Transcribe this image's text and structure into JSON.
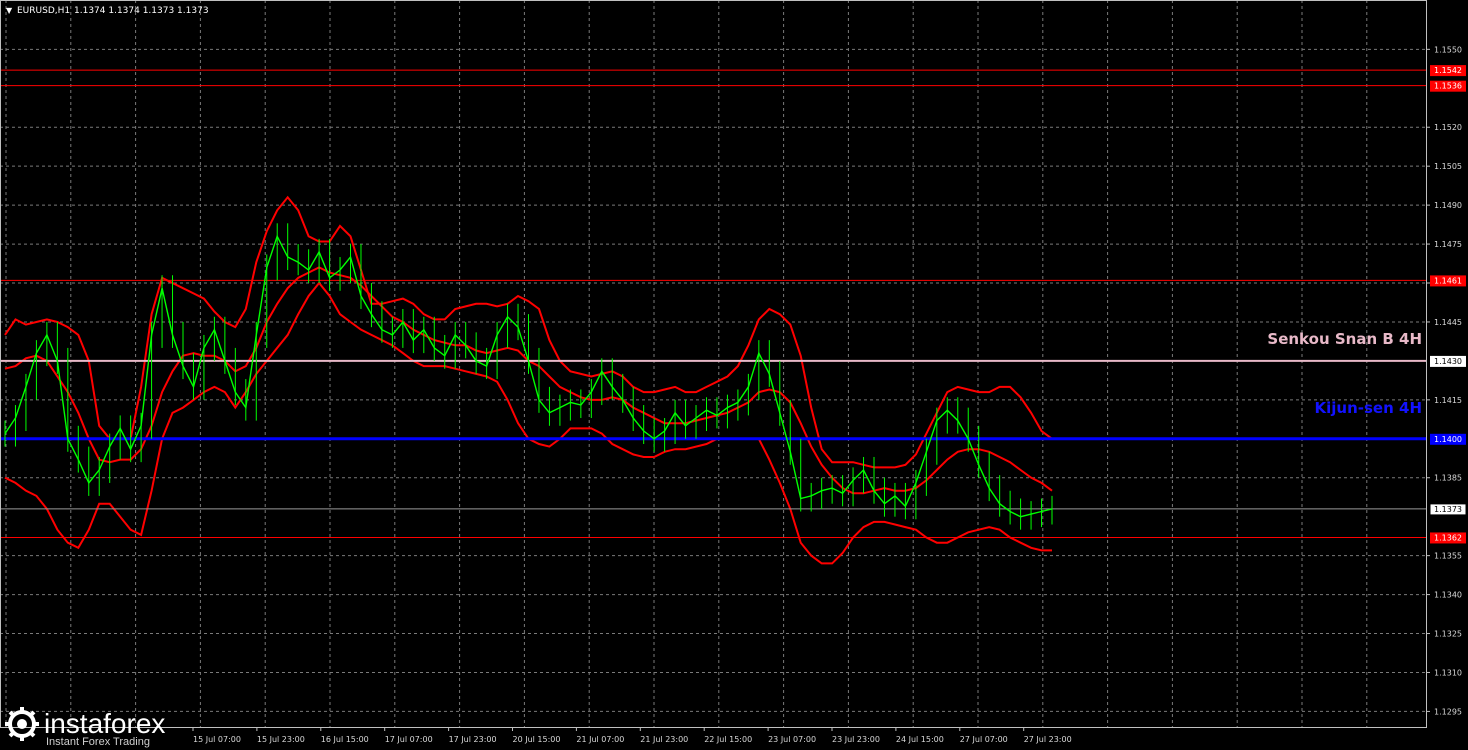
{
  "header": {
    "symbol": "EURUSD,H1",
    "ohlc": "1.1374 1.1374 1.1373 1.1373"
  },
  "watermark": {
    "brand": "instaforex",
    "tagline": "Instant Forex Trading"
  },
  "colors": {
    "background": "#000000",
    "candles": "#00ff00",
    "indicator_lines": "#ff0000",
    "level_lines": "#ff0000",
    "senkou_span_b": "#e8b9c8",
    "kijun_sen": "#0000ff"
  },
  "chart_data": {
    "type": "line",
    "ylim": [
      1.1289,
      1.1569
    ],
    "y_ticks": [
      "1.1295",
      "1.1310",
      "1.1325",
      "1.1340",
      "1.1355",
      "1.1385",
      "1.1415",
      "1.1445",
      "1.1460",
      "1.1475",
      "1.1490",
      "1.1505",
      "1.1520",
      "1.1550"
    ],
    "x_ticks": [
      "15 Jul 07:00",
      "15 Jul 23:00",
      "16 Jul 15:00",
      "17 Jul 07:00",
      "17 Jul 23:00",
      "20 Jul 15:00",
      "21 Jul 07:00",
      "21 Jul 23:00",
      "22 Jul 15:00",
      "23 Jul 07:00",
      "23 Jul 23:00",
      "24 Jul 15:00",
      "27 Jul 07:00",
      "27 Jul 23:00"
    ],
    "levels": [
      {
        "label": "1.1542",
        "value": 1.1542,
        "kind": "red"
      },
      {
        "label": "1.1536",
        "value": 1.1536,
        "kind": "red"
      },
      {
        "label": "1.1461",
        "value": 1.1461,
        "kind": "red"
      },
      {
        "label": "1.1362",
        "value": 1.1362,
        "kind": "red"
      },
      {
        "label": "1.1430",
        "value": 1.143,
        "kind": "senkou"
      },
      {
        "label": "1.1400",
        "value": 1.14,
        "kind": "kijun"
      },
      {
        "label": "1.1373",
        "value": 1.1373,
        "kind": "current"
      }
    ],
    "annotations": {
      "senkou": "Senkou Snan B 4H",
      "kijun": "Kijun-sen 4H"
    },
    "price": [
      1.1402,
      1.1408,
      1.142,
      1.1433,
      1.144,
      1.143,
      1.14,
      1.1392,
      1.1383,
      1.1388,
      1.1397,
      1.1404,
      1.1396,
      1.1405,
      1.144,
      1.1458,
      1.144,
      1.1428,
      1.142,
      1.1435,
      1.1442,
      1.143,
      1.1418,
      1.1412,
      1.144,
      1.1466,
      1.1478,
      1.147,
      1.1468,
      1.1465,
      1.1472,
      1.1462,
      1.1465,
      1.147,
      1.1455,
      1.1448,
      1.1442,
      1.144,
      1.1445,
      1.1438,
      1.1442,
      1.1435,
      1.1432,
      1.144,
      1.1436,
      1.143,
      1.1428,
      1.144,
      1.1447,
      1.1443,
      1.143,
      1.1415,
      1.141,
      1.1412,
      1.1414,
      1.1413,
      1.1418,
      1.1426,
      1.142,
      1.1415,
      1.1408,
      1.1403,
      1.14,
      1.1403,
      1.141,
      1.1405,
      1.1408,
      1.1411,
      1.1409,
      1.1412,
      1.1414,
      1.142,
      1.1433,
      1.1425,
      1.141,
      1.1395,
      1.1377,
      1.1378,
      1.138,
      1.1381,
      1.1379,
      1.1384,
      1.1388,
      1.138,
      1.1375,
      1.1378,
      1.1374,
      1.1383,
      1.1395,
      1.1407,
      1.1411,
      1.1407,
      1.14,
      1.139,
      1.1381,
      1.1375,
      1.1372,
      1.137,
      1.1371,
      1.1372,
      1.1373
    ],
    "bands": {
      "upper": [
        1.144,
        1.1446,
        1.1444,
        1.1445,
        1.1446,
        1.1445,
        1.1443,
        1.144,
        1.143,
        1.1405,
        1.14,
        1.14,
        1.14,
        1.142,
        1.1448,
        1.1462,
        1.146,
        1.1458,
        1.1456,
        1.1454,
        1.1449,
        1.1445,
        1.1443,
        1.145,
        1.1468,
        1.148,
        1.1488,
        1.1493,
        1.1488,
        1.1478,
        1.1476,
        1.1476,
        1.1482,
        1.1478,
        1.1465,
        1.1452,
        1.1452,
        1.1453,
        1.1454,
        1.1452,
        1.1448,
        1.1446,
        1.1446,
        1.145,
        1.1451,
        1.1452,
        1.1452,
        1.1451,
        1.1452,
        1.1455,
        1.1453,
        1.145,
        1.1438,
        1.143,
        1.1426,
        1.1425,
        1.1424,
        1.1425,
        1.1426,
        1.1424,
        1.142,
        1.1418,
        1.1418,
        1.1419,
        1.142,
        1.1418,
        1.1418,
        1.142,
        1.1422,
        1.1424,
        1.1428,
        1.1436,
        1.1446,
        1.145,
        1.1448,
        1.1444,
        1.1432,
        1.1412,
        1.1396,
        1.1391,
        1.1391,
        1.1391,
        1.139,
        1.1389,
        1.1389,
        1.1389,
        1.139,
        1.1394,
        1.1402,
        1.141,
        1.1418,
        1.142,
        1.1419,
        1.1418,
        1.1418,
        1.142,
        1.142,
        1.1416,
        1.141,
        1.1403,
        1.14
      ],
      "middle": [
        1.1427,
        1.1428,
        1.1431,
        1.1432,
        1.143,
        1.1424,
        1.1418,
        1.141,
        1.14,
        1.1392,
        1.1391,
        1.1392,
        1.1392,
        1.1396,
        1.1405,
        1.1418,
        1.1426,
        1.1432,
        1.1433,
        1.1432,
        1.1432,
        1.143,
        1.1426,
        1.1428,
        1.1435,
        1.1445,
        1.1452,
        1.1458,
        1.1462,
        1.1464,
        1.1466,
        1.1464,
        1.1463,
        1.1462,
        1.1459,
        1.1455,
        1.1451,
        1.1447,
        1.1445,
        1.1442,
        1.144,
        1.1438,
        1.1437,
        1.1436,
        1.1436,
        1.1434,
        1.1433,
        1.1434,
        1.1435,
        1.1434,
        1.143,
        1.1428,
        1.1424,
        1.142,
        1.1418,
        1.1416,
        1.1415,
        1.1415,
        1.1416,
        1.1415,
        1.1412,
        1.141,
        1.1408,
        1.1406,
        1.1406,
        1.1406,
        1.1407,
        1.1408,
        1.1409,
        1.141,
        1.1412,
        1.1414,
        1.1418,
        1.1419,
        1.1418,
        1.1414,
        1.1406,
        1.1397,
        1.139,
        1.1385,
        1.1381,
        1.1379,
        1.1379,
        1.138,
        1.1381,
        1.138,
        1.138,
        1.1381,
        1.1384,
        1.1388,
        1.1392,
        1.1395,
        1.1396,
        1.1396,
        1.1395,
        1.1393,
        1.1391,
        1.1388,
        1.1385,
        1.1383,
        1.138
      ],
      "lower": [
        1.1385,
        1.1383,
        1.138,
        1.1378,
        1.1373,
        1.1365,
        1.136,
        1.1358,
        1.1365,
        1.1375,
        1.1375,
        1.137,
        1.1365,
        1.1363,
        1.138,
        1.14,
        1.141,
        1.1412,
        1.1415,
        1.1418,
        1.142,
        1.1418,
        1.1412,
        1.1418,
        1.1425,
        1.143,
        1.1435,
        1.144,
        1.1448,
        1.1455,
        1.146,
        1.1455,
        1.1448,
        1.1445,
        1.1442,
        1.144,
        1.1438,
        1.1436,
        1.1433,
        1.143,
        1.1428,
        1.1428,
        1.1428,
        1.1427,
        1.1426,
        1.1425,
        1.1424,
        1.1422,
        1.1415,
        1.1406,
        1.14,
        1.1398,
        1.1397,
        1.14,
        1.1404,
        1.1404,
        1.1404,
        1.1402,
        1.1398,
        1.1396,
        1.1394,
        1.1393,
        1.1393,
        1.1395,
        1.1396,
        1.1396,
        1.1397,
        1.1398,
        1.14,
        1.14,
        1.14,
        1.14,
        1.14,
        1.1392,
        1.1383,
        1.1373,
        1.136,
        1.1355,
        1.1352,
        1.1352,
        1.1356,
        1.1362,
        1.1366,
        1.1368,
        1.1368,
        1.1367,
        1.1366,
        1.1365,
        1.1362,
        1.136,
        1.136,
        1.1362,
        1.1364,
        1.1365,
        1.1366,
        1.1365,
        1.1362,
        1.136,
        1.1358,
        1.1357,
        1.1357
      ]
    }
  }
}
